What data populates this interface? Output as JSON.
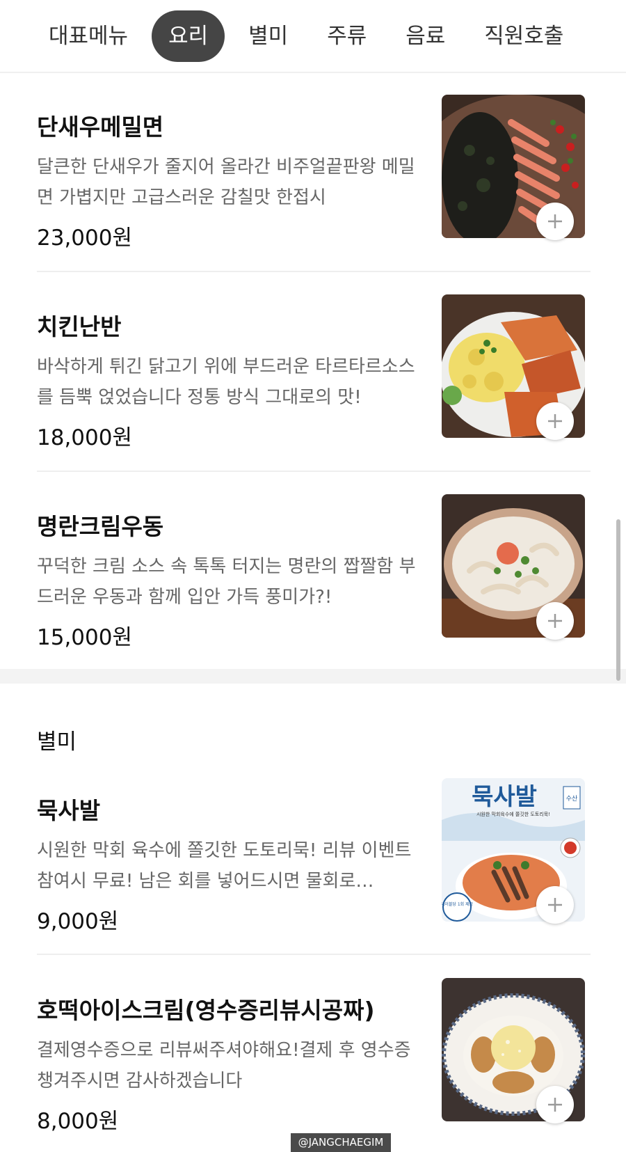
{
  "tabs": [
    "대표메뉴",
    "요리",
    "별미",
    "주류",
    "음료",
    "직원호출"
  ],
  "active_tab": "요리",
  "items": [
    {
      "name": "단새우메밀면",
      "desc": "달큰한 단새우가 줄지어 올라간 비주얼끝판왕 메밀면 가볍지만 고급스러운 감칠맛 한접시",
      "price": "23,000원"
    },
    {
      "name": "치킨난반",
      "desc": "바삭하게 튀긴 닭고기 위에 부드러운 타르타르소스를 듬뿍 얹었습니다 정통 방식 그대로의 맛!",
      "price": "18,000원"
    },
    {
      "name": "명란크림우동",
      "desc": "꾸덕한 크림 소스 속 톡톡 터지는 명란의 짭짤함 부드러운 우동과 함께 입안 가득 풍미가?!",
      "price": "15,000원"
    },
    {
      "name": "묵사발",
      "desc": "시원한 막회 육수에 쫄깃한 도토리묵! 리뷰 이벤트 참여시 무료! 남은 회를 넣어드시면 물회로…",
      "price": "9,000원"
    },
    {
      "name": "호떡아이스크림(영수증리뷰시공짜)",
      "desc": "결제영수증으로 리뷰써주셔야해요!결제 후 영수증 챙겨주시면 감사하겠습니다",
      "price": "8,000원"
    }
  ],
  "section_title": "별미",
  "poster": {
    "title": "묵사발",
    "brand": "수산",
    "subtitle": "시원한 막회육수에 쫄깃한 도토리묵!",
    "badge": "테이블당 1회 제공"
  },
  "watermark": "@JANGCHAEGIM"
}
